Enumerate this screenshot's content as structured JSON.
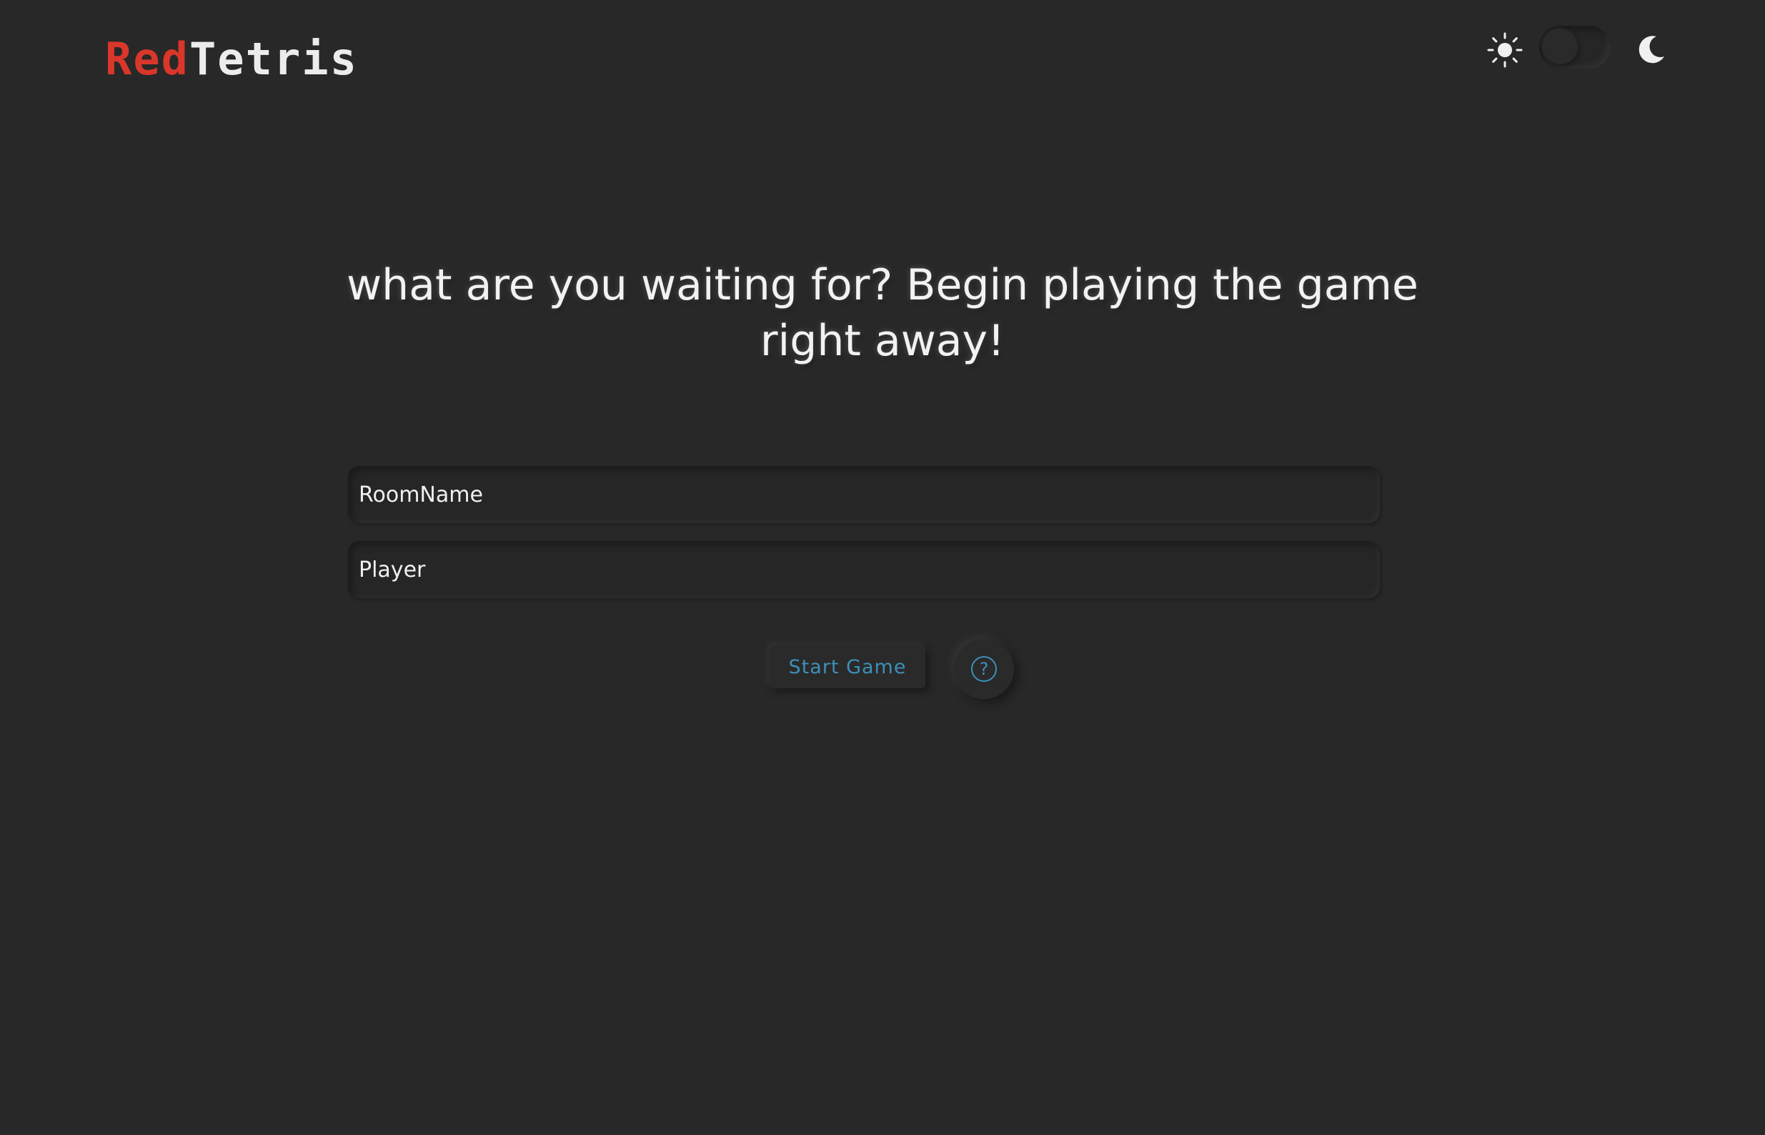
{
  "header": {
    "logo_red": "Red",
    "logo_white": "Tetris",
    "theme": {
      "light_icon": "sun-icon",
      "dark_icon": "moon-icon",
      "mode": "dark"
    }
  },
  "main": {
    "headline_line1": "what are you waiting for? Begin playing the game",
    "headline_line2": "right away!",
    "room_input": {
      "placeholder": "RoomName",
      "value": ""
    },
    "player_input": {
      "placeholder": "Player",
      "value": ""
    },
    "start_label": "Start Game",
    "help_label": "?"
  },
  "colors": {
    "background": "#282828",
    "logo_accent": "#d9372a",
    "button_text": "#3d8fb8"
  }
}
